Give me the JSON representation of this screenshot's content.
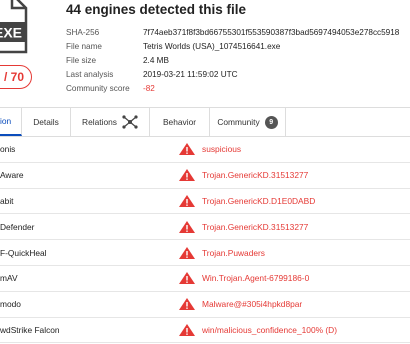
{
  "header": {
    "file_type_label": "EXE",
    "title": "44 engines detected this file"
  },
  "detection_score": "/ 70",
  "meta": [
    {
      "label": "SHA-256",
      "value": "7f74aeb371f8f3bd66755301f553590387f3bad5697494053e278cc5918"
    },
    {
      "label": "File name",
      "value": "Tetris Worlds (USA)_1074516641.exe"
    },
    {
      "label": "File size",
      "value": "2.4 MB"
    },
    {
      "label": "Last analysis",
      "value": "2019-03-21 11:59:02 UTC"
    },
    {
      "label": "Community score",
      "value": "-82"
    }
  ],
  "tabs": [
    {
      "label": "ion",
      "active": true
    },
    {
      "label": "Details"
    },
    {
      "label": "Relations"
    },
    {
      "label": "Behavior"
    },
    {
      "label": "Community",
      "badge": "9"
    }
  ],
  "results": [
    {
      "engine": "onis",
      "verdict": "suspicious"
    },
    {
      "engine": "Aware",
      "verdict": "Trojan.GenericKD.31513277"
    },
    {
      "engine": "abit",
      "verdict": "Trojan.GenericKD.D1E0DABD"
    },
    {
      "engine": "Defender",
      "verdict": "Trojan.GenericKD.31513277"
    },
    {
      "engine": "F-QuickHeal",
      "verdict": "Trojan.Puwaders"
    },
    {
      "engine": "mAV",
      "verdict": "Win.Trojan.Agent-6799186-0"
    },
    {
      "engine": "modo",
      "verdict": "Malware@#305i4hpkd8par"
    },
    {
      "engine": "wdStrike Falcon",
      "verdict": "win/malicious_confidence_100% (D)"
    }
  ],
  "colors": {
    "accent_red": "#e53935",
    "tab_active": "#0b4dbc"
  }
}
